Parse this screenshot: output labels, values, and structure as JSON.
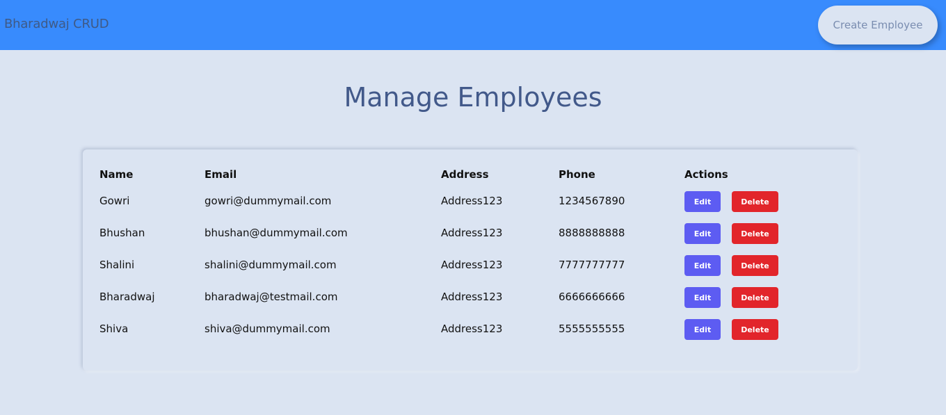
{
  "navbar": {
    "brand": "Bharadwaj CRUD",
    "create_button": "Create Employee"
  },
  "page": {
    "title": "Manage Employees"
  },
  "table": {
    "headers": [
      "Name",
      "Email",
      "Address",
      "Phone",
      "Actions"
    ],
    "rows": [
      {
        "name": "Gowri",
        "email": "gowri@dummymail.com",
        "address": "Address123",
        "phone": "1234567890",
        "edit": "Edit",
        "delete": "Delete"
      },
      {
        "name": "Bhushan",
        "email": "bhushan@dummymail.com",
        "address": "Address123",
        "phone": "8888888888",
        "edit": "Edit",
        "delete": "Delete"
      },
      {
        "name": "Shalini",
        "email": "shalini@dummymail.com",
        "address": "Address123",
        "phone": "7777777777",
        "edit": "Edit",
        "delete": "Delete"
      },
      {
        "name": "Bharadwaj",
        "email": "bharadwaj@testmail.com",
        "address": "Address123",
        "phone": "6666666666",
        "edit": "Edit",
        "delete": "Delete"
      },
      {
        "name": "Shiva",
        "email": "shiva@dummymail.com",
        "address": "Address123",
        "phone": "5555555555",
        "edit": "Edit",
        "delete": "Delete"
      }
    ]
  },
  "colors": {
    "navbar": "#388bfd",
    "background": "#dbe4f2",
    "title": "#42598a",
    "edit": "#5d5cf2",
    "delete": "#e2252b"
  }
}
